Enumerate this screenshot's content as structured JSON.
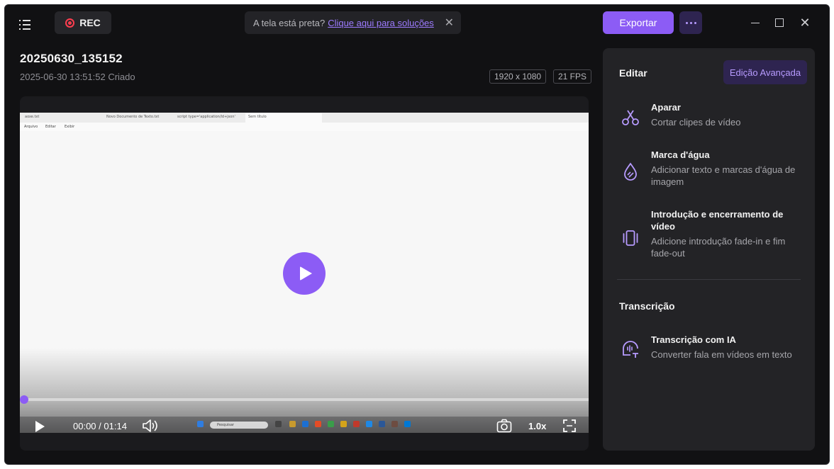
{
  "toolbar": {
    "rec_label": "REC",
    "notice_text": "A tela está preta?",
    "notice_link": "Clique aqui para soluções",
    "export_label": "Exportar"
  },
  "video": {
    "title": "20250630_135152",
    "created": "2025-06-30 13:51:52 Criado",
    "resolution": "1920 x 1080",
    "fps": "21 FPS",
    "time_current": "00:00",
    "time_total": "01:14",
    "speed": "1.0x",
    "progress": 0
  },
  "recorded_screen": {
    "tabs": [
      "aoxe.txt",
      "Novo Documento de Texto.txt",
      "script type='application/ld+json'",
      "Sem título"
    ],
    "menu": [
      "Arquivo",
      "Editar",
      "Exibir"
    ],
    "search_placeholder": "Pesquisar"
  },
  "panel": {
    "edit_header": "Editar",
    "advanced_label": "Edição Avançada",
    "features": [
      {
        "title": "Aparar",
        "desc": "Cortar clipes de vídeo"
      },
      {
        "title": "Marca d'água",
        "desc": "Adicionar texto e marcas d'água de imagem"
      },
      {
        "title": "Introdução e encerramento de vídeo",
        "desc": "Adicione introdução fade-in e fim fade-out"
      }
    ],
    "transcription_header": "Transcrição",
    "transcription": {
      "title": "Transcrição com IA",
      "desc": "Converter fala em vídeos em texto"
    }
  },
  "colors": {
    "accent": "#8c5cf5",
    "background": "#111113",
    "panel": "#232326",
    "rec_red": "#ff3d4f"
  }
}
